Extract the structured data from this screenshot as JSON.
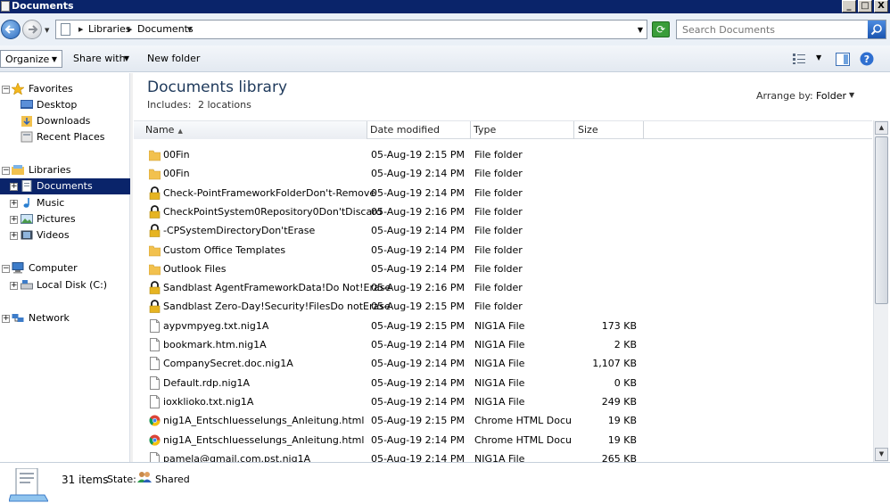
{
  "window": {
    "title": "Documents",
    "btn_min": "_",
    "btn_max": "□",
    "btn_close": "X"
  },
  "address": {
    "breadcrumbs": [
      "Libraries",
      "Documents"
    ],
    "search_placeholder": "Search Documents"
  },
  "toolbar": {
    "organize": "Organize",
    "share_with": "Share with",
    "new_folder": "New folder"
  },
  "nav": {
    "favorites": "Favorites",
    "desktop": "Desktop",
    "downloads": "Downloads",
    "recent_places": "Recent Places",
    "libraries": "Libraries",
    "documents": "Documents",
    "music": "Music",
    "pictures": "Pictures",
    "videos": "Videos",
    "computer": "Computer",
    "local_disk": "Local Disk (C:)",
    "network": "Network"
  },
  "library": {
    "title": "Documents library",
    "includes_label": "Includes:",
    "includes_value": "2 locations",
    "arrange_label": "Arrange by:",
    "arrange_value": "Folder"
  },
  "columns": {
    "name": "Name",
    "date": "Date modified",
    "type": "Type",
    "size": "Size"
  },
  "files": [
    {
      "name": "00Fin",
      "date": "05-Aug-19 2:15 PM",
      "type": "File folder",
      "size": "",
      "icon": "folder-icon"
    },
    {
      "name": "00Fin",
      "date": "05-Aug-19 2:14 PM",
      "type": "File folder",
      "size": "",
      "icon": "folder-icon"
    },
    {
      "name": "Check-PointFrameworkFolderDon't-Remove",
      "date": "05-Aug-19 2:14 PM",
      "type": "File folder",
      "size": "",
      "icon": "locked-folder-icon"
    },
    {
      "name": "CheckPointSystem0Repository0Don'tDiscard",
      "date": "05-Aug-19 2:16 PM",
      "type": "File folder",
      "size": "",
      "icon": "locked-folder-icon"
    },
    {
      "name": "-CPSystemDirectoryDon'tErase",
      "date": "05-Aug-19 2:14 PM",
      "type": "File folder",
      "size": "",
      "icon": "locked-folder-icon"
    },
    {
      "name": "Custom Office Templates",
      "date": "05-Aug-19 2:14 PM",
      "type": "File folder",
      "size": "",
      "icon": "folder-icon"
    },
    {
      "name": "Outlook Files",
      "date": "05-Aug-19 2:14 PM",
      "type": "File folder",
      "size": "",
      "icon": "folder-icon"
    },
    {
      "name": "Sandblast AgentFrameworkData!Do Not!Erase",
      "date": "05-Aug-19 2:16 PM",
      "type": "File folder",
      "size": "",
      "icon": "locked-folder-icon"
    },
    {
      "name": "Sandblast Zero-Day!Security!FilesDo notErase",
      "date": "05-Aug-19 2:15 PM",
      "type": "File folder",
      "size": "",
      "icon": "locked-folder-icon"
    },
    {
      "name": "aypvmpyeg.txt.nig1A",
      "date": "05-Aug-19 2:15 PM",
      "type": "NIG1A File",
      "size": "173 KB",
      "icon": "file-icon"
    },
    {
      "name": "bookmark.htm.nig1A",
      "date": "05-Aug-19 2:14 PM",
      "type": "NIG1A File",
      "size": "2 KB",
      "icon": "file-icon"
    },
    {
      "name": "CompanySecret.doc.nig1A",
      "date": "05-Aug-19 2:14 PM",
      "type": "NIG1A File",
      "size": "1,107 KB",
      "icon": "file-icon"
    },
    {
      "name": "Default.rdp.nig1A",
      "date": "05-Aug-19 2:14 PM",
      "type": "NIG1A File",
      "size": "0 KB",
      "icon": "file-icon"
    },
    {
      "name": "ioxklioko.txt.nig1A",
      "date": "05-Aug-19 2:14 PM",
      "type": "NIG1A File",
      "size": "249 KB",
      "icon": "file-icon"
    },
    {
      "name": "nig1A_Entschluesselungs_Anleitung.html",
      "date": "05-Aug-19 2:15 PM",
      "type": "Chrome HTML Docu...",
      "size": "19 KB",
      "icon": "chrome-icon"
    },
    {
      "name": "nig1A_Entschluesselungs_Anleitung.html",
      "date": "05-Aug-19 2:14 PM",
      "type": "Chrome HTML Docu...",
      "size": "19 KB",
      "icon": "chrome-icon"
    },
    {
      "name": "pamela@gmail.com.pst.nig1A",
      "date": "05-Aug-19 2:14 PM",
      "type": "NIG1A File",
      "size": "265 KB",
      "icon": "file-icon"
    }
  ],
  "status": {
    "count": "31 items",
    "state_label": "State:",
    "state_value": "Shared"
  },
  "colors": {
    "selection": "#0a246a",
    "folder": "#f2c14e",
    "lock": "#e6b422"
  }
}
